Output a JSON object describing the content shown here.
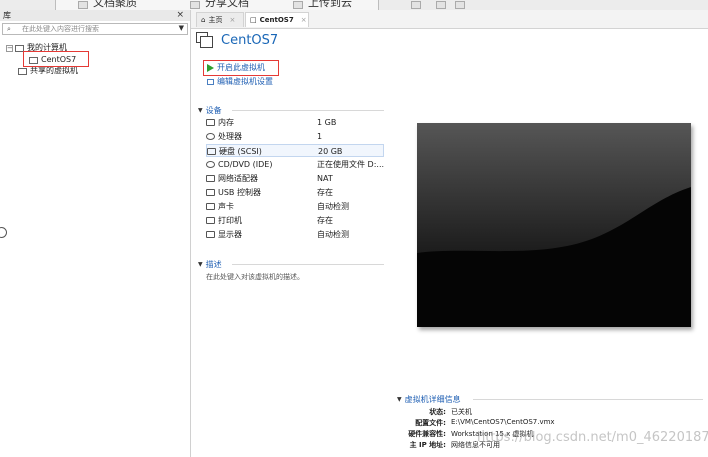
{
  "top_strip": {
    "frag1": "文档聚质",
    "frag2": "分享文档",
    "frag3": "上传到云"
  },
  "library": {
    "title": "库",
    "close": "×",
    "search_placeholder": "在此处键入内容进行搜索",
    "tree": {
      "my_computer": "我的计算机",
      "vm_name": "CentOS7",
      "shared": "共享的虚拟机"
    }
  },
  "tabs": [
    {
      "label": "主页",
      "close": "×"
    },
    {
      "label": "CentOS7",
      "close": "×"
    }
  ],
  "vm": {
    "title": "CentOS7",
    "actions": {
      "power_on": "开启此虚拟机",
      "edit_settings": "编辑虚拟机设置"
    }
  },
  "devices": {
    "heading": "设备",
    "rows": [
      {
        "name": "内存",
        "value": "1 GB",
        "icon": "memory-icon"
      },
      {
        "name": "处理器",
        "value": "1",
        "icon": "cpu-icon"
      },
      {
        "name": "硬盘 (SCSI)",
        "value": "20 GB",
        "icon": "harddisk-icon"
      },
      {
        "name": "CD/DVD (IDE)",
        "value": "正在使用文件 D:...",
        "icon": "cd-icon"
      },
      {
        "name": "网络适配器",
        "value": "NAT",
        "icon": "network-icon"
      },
      {
        "name": "USB 控制器",
        "value": "存在",
        "icon": "usb-icon"
      },
      {
        "name": "声卡",
        "value": "自动检测",
        "icon": "speaker-icon"
      },
      {
        "name": "打印机",
        "value": "存在",
        "icon": "printer-icon"
      },
      {
        "name": "显示器",
        "value": "自动检测",
        "icon": "display-icon"
      }
    ]
  },
  "description": {
    "heading": "描述",
    "placeholder": "在此处键入对该虚拟机的描述。"
  },
  "details": {
    "heading": "虚拟机详细信息",
    "rows": [
      {
        "key": "状态:",
        "value": "已关机"
      },
      {
        "key": "配置文件:",
        "value": "E:\\VM\\CentOS7\\CentOS7.vmx"
      },
      {
        "key": "硬件兼容性:",
        "value": "Workstation 15.x 虚拟机"
      },
      {
        "key": "主 IP 地址:",
        "value": "网络信息不可用"
      }
    ]
  },
  "watermark": "https://blog.csdn.net/m0_46220187",
  "colors": {
    "accent": "#1f5fb3",
    "highlight": "#e53935",
    "play": "#2e9e2e"
  }
}
